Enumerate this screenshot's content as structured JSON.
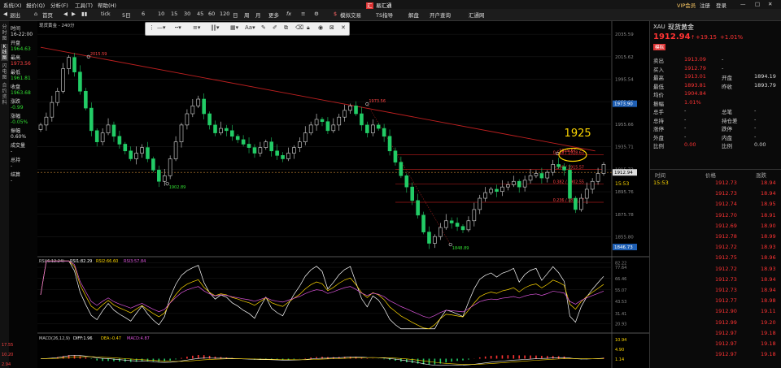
{
  "menu": [
    "系统(X)",
    "报价(Q)",
    "分析(F)",
    "工具(T)",
    "帮助(H)"
  ],
  "app_title": "易汇通",
  "window_right": [
    "VIP会员",
    "注册",
    "登录"
  ],
  "toolbar": {
    "items": [
      "退出",
      "首页",
      "tick",
      "5日",
      "6",
      "10",
      "15",
      "30",
      "45",
      "60",
      "120",
      "日",
      "周",
      "月",
      "更多",
      "fx",
      "模拟交易",
      "TS指导",
      "解盘",
      "开户查询",
      "汇通网"
    ]
  },
  "sidebar_tabs": [
    "分时图",
    "K线图",
    "闪电图",
    "合约资料"
  ],
  "info_panel": [
    {
      "t": "时间",
      "c": "#ddd"
    },
    {
      "t": "16-22:00",
      "c": "#ddd"
    },
    {
      "t": "开盘",
      "c": "#ddd"
    },
    {
      "t": "1964.63",
      "c": "#33dd33"
    },
    {
      "t": "最高",
      "c": "#ddd"
    },
    {
      "t": "1973.56",
      "c": "#ff4444"
    },
    {
      "t": "最低",
      "c": "#ddd"
    },
    {
      "t": "1961.81",
      "c": "#33dd33"
    },
    {
      "t": "收盘",
      "c": "#ddd"
    },
    {
      "t": "1963.68",
      "c": "#33dd33"
    },
    {
      "t": "涨跌",
      "c": "#ddd"
    },
    {
      "t": "-0.99",
      "c": "#33dd33"
    },
    {
      "t": "涨幅",
      "c": "#ddd"
    },
    {
      "t": "-0.05%",
      "c": "#33dd33"
    },
    {
      "t": "振幅",
      "c": "#ddd"
    },
    {
      "t": "0.60%",
      "c": "#ddd"
    },
    {
      "t": "成交量",
      "c": "#ddd"
    },
    {
      "t": "-",
      "c": "#ddd"
    },
    {
      "t": "总持",
      "c": "#ddd"
    },
    {
      "t": "-",
      "c": "#ddd"
    },
    {
      "t": "结算",
      "c": "#ddd"
    },
    {
      "t": "-",
      "c": "#ddd"
    }
  ],
  "chart_data": {
    "type": "candlestick",
    "symbol_label": "现货黄金 - 240分",
    "ylim": [
      1841,
      2040
    ],
    "y_ticks": [
      "2035.59",
      "2015.62",
      "1995.54",
      "1975.66",
      "1955.66",
      "1935.71",
      "1915.73",
      "1895.76",
      "1875.78",
      "1855.80"
    ],
    "current_price": 1912.94,
    "current_time": "15:53",
    "highlight_price_tag": "1973.90",
    "low_price_tag": "1846.73",
    "annotations": [
      {
        "label": "2015.59",
        "x": 0.085,
        "y": 2015.59
      },
      {
        "label": "1902.89",
        "x": 0.225,
        "y": 1902.89
      },
      {
        "label": "1973.56",
        "x": 0.58,
        "y": 1973.56
      },
      {
        "label": "1848.89",
        "x": 0.728,
        "y": 1848.89
      },
      {
        "label": "1929.67",
        "x": 0.918,
        "y": 1929.67
      }
    ],
    "fib_levels": [
      {
        "label": "0.618 / 1928.63",
        "y": 1928.6
      },
      {
        "label": "0.500 / 1915.57",
        "y": 1915.6
      },
      {
        "label": "0.382 / 1902.55",
        "y": 1902.5
      },
      {
        "label": "0.236 / 1878.37",
        "y": 1886.4
      }
    ],
    "callout": "1925",
    "close_series": [
      1955,
      1962,
      1975,
      1985,
      2005,
      2015,
      2002,
      1985,
      1970,
      1950,
      1940,
      1948,
      1955,
      1945,
      1938,
      1932,
      1925,
      1930,
      1935,
      1925,
      1915,
      1905,
      1910,
      1925,
      1940,
      1955,
      1965,
      1972,
      1978,
      1965,
      1955,
      1948,
      1952,
      1950,
      1945,
      1942,
      1938,
      1935,
      1930,
      1935,
      1940,
      1932,
      1928,
      1925,
      1930,
      1935,
      1940,
      1948,
      1955,
      1960,
      1958,
      1950,
      1955,
      1962,
      1968,
      1972,
      1965,
      1955,
      1948,
      1955,
      1952,
      1945,
      1932,
      1922,
      1910,
      1900,
      1888,
      1875,
      1860,
      1850,
      1856,
      1864,
      1870,
      1868,
      1865,
      1862,
      1870,
      1880,
      1890,
      1895,
      1898,
      1896,
      1900,
      1902,
      1905,
      1900,
      1906,
      1910,
      1912,
      1908,
      1913,
      1920,
      1918,
      1915,
      1890,
      1880,
      1890,
      1898,
      1905,
      1912,
      1920
    ],
    "rsi": {
      "title": "RSI(6,12,24)",
      "rsi1": "RSI1:82.29",
      "rsi2": "RSI2:66.60",
      "rsi3": "RSI3:57.84",
      "y_ticks": [
        "82.22",
        "77.64",
        "66.46",
        "55.07",
        "43.53",
        "31.41",
        "20.93"
      ]
    },
    "macd": {
      "title": "MACD(26,12,9)",
      "diff": "DIFF:1.96",
      "dea": "DEA:-0.47",
      "macd": "MACD:4.87",
      "y_ticks": [
        "10.94",
        "4.90",
        "1.14"
      ],
      "left_ticks": [
        "17.55",
        "10.20",
        "2.94"
      ]
    }
  },
  "right_panel": {
    "code": "XAU",
    "name": "现货黄金",
    "price": "1912.94",
    "change": "+19.15",
    "change_pct": "+1.01%",
    "button_label": "模拟",
    "stats": [
      [
        "卖出",
        "1913.09",
        "-",
        ""
      ],
      [
        "买入",
        "1912.79",
        "-",
        ""
      ],
      [
        "最高",
        "1913.01",
        "开盘",
        "1894.19"
      ],
      [
        "最低",
        "1893.81",
        "昨收",
        "1893.79"
      ],
      [
        "均价",
        "1904.84",
        "",
        ""
      ],
      [
        "振幅",
        "1.01%",
        "",
        ""
      ],
      [
        "总手",
        "-",
        "总笔",
        "-"
      ],
      [
        "总持",
        "-",
        "持仓差",
        "-"
      ],
      [
        "涨停",
        "-",
        "跌停",
        "-"
      ],
      [
        "外盘",
        "-",
        "内盘",
        "-"
      ],
      [
        "比例",
        "0.00",
        "比例",
        "0.00"
      ]
    ],
    "ticks_header": [
      "时间",
      "价格",
      "涨跌"
    ],
    "ticks": [
      [
        "15:53",
        "1912.73",
        "18.94"
      ],
      [
        "",
        "1912.73",
        "18.94"
      ],
      [
        "",
        "1912.74",
        "18.95"
      ],
      [
        "",
        "1912.70",
        "18.91"
      ],
      [
        "",
        "1912.69",
        "18.90"
      ],
      [
        "",
        "1912.78",
        "18.99"
      ],
      [
        "",
        "1912.72",
        "18.93"
      ],
      [
        "",
        "1912.75",
        "18.96"
      ],
      [
        "",
        "1912.72",
        "18.93"
      ],
      [
        "",
        "1912.73",
        "18.94"
      ],
      [
        "",
        "1912.73",
        "18.94"
      ],
      [
        "",
        "1912.77",
        "18.98"
      ],
      [
        "",
        "1912.90",
        "19.11"
      ],
      [
        "",
        "1912.99",
        "19.20"
      ],
      [
        "",
        "1912.97",
        "19.18"
      ],
      [
        "",
        "1912.97",
        "19.18"
      ],
      [
        "",
        "1912.97",
        "19.18"
      ]
    ]
  },
  "colors": {
    "up": "#ff3333",
    "down": "#22cc55",
    "accent": "#ffd700",
    "blue": "#1e5fb4"
  }
}
